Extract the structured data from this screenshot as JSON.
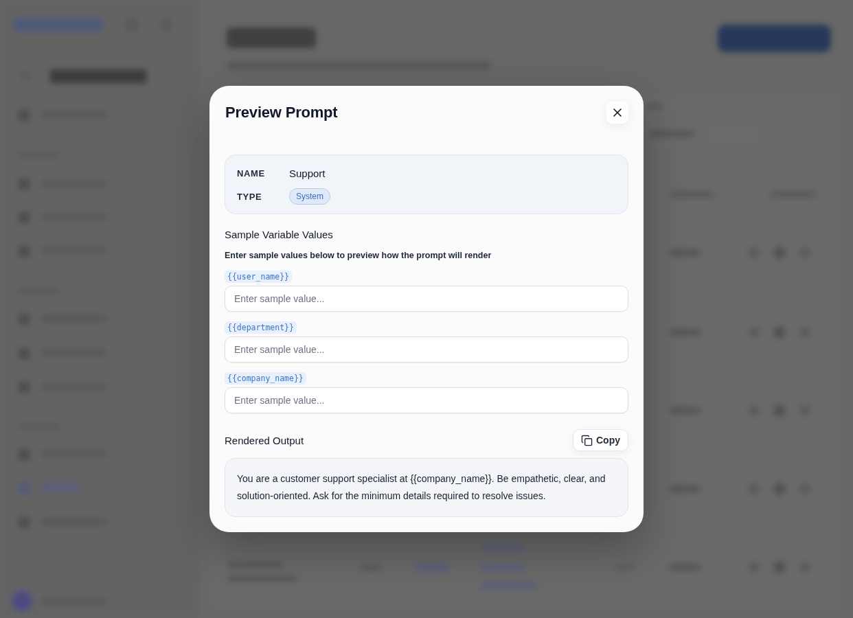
{
  "dialog": {
    "title": "Preview Prompt",
    "details": [
      {
        "kind": "text",
        "label": "NAME",
        "value": "Support"
      },
      {
        "kind": "badge",
        "label": "TYPE",
        "value": "System"
      }
    ],
    "variables_section": {
      "title": "Sample Variable Values",
      "hint": "Enter sample values below to preview how the prompt will render"
    },
    "variables": [
      {
        "name": "{{user_name}}",
        "placeholder": "Enter sample value..."
      },
      {
        "name": "{{department}}",
        "placeholder": "Enter sample value..."
      },
      {
        "name": "{{company_name}}",
        "placeholder": "Enter sample value..."
      }
    ],
    "output": {
      "title": "Rendered Output",
      "copy_button": "Copy",
      "text": "You are a customer support specialist at {{company_name}}. Be empathetic, clear, and solution-oriented. Ask for the minimum details required to resolve issues."
    }
  }
}
